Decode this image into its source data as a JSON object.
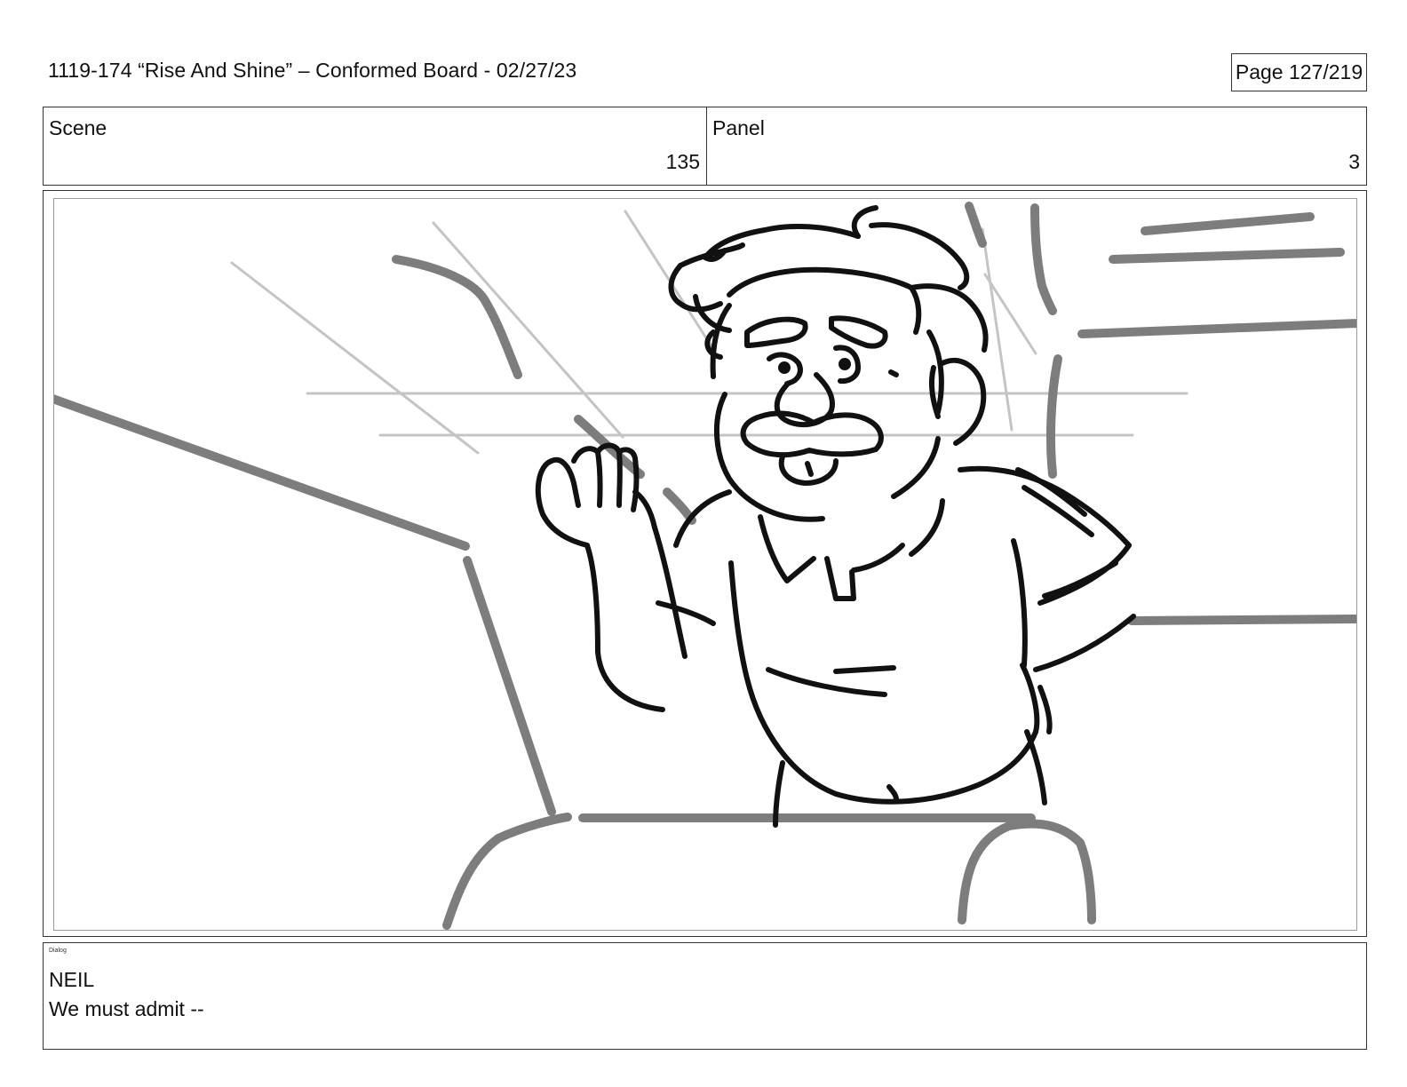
{
  "header": {
    "title": "1119-174 “Rise And Shine” – Conformed Board - 02/27/23",
    "page": "Page 127/219"
  },
  "scene": {
    "label": "Scene",
    "value": "135"
  },
  "panel": {
    "label": "Panel",
    "value": "3"
  },
  "dialog": {
    "label": "Dialog",
    "speaker": "NEIL",
    "line": "We must admit --"
  },
  "artwork": {
    "icon": "storyboard-sketch-neil",
    "line_color": "#111111",
    "background_line_color": "#7d7d7d",
    "guide_line_color": "#bdbdbd"
  }
}
